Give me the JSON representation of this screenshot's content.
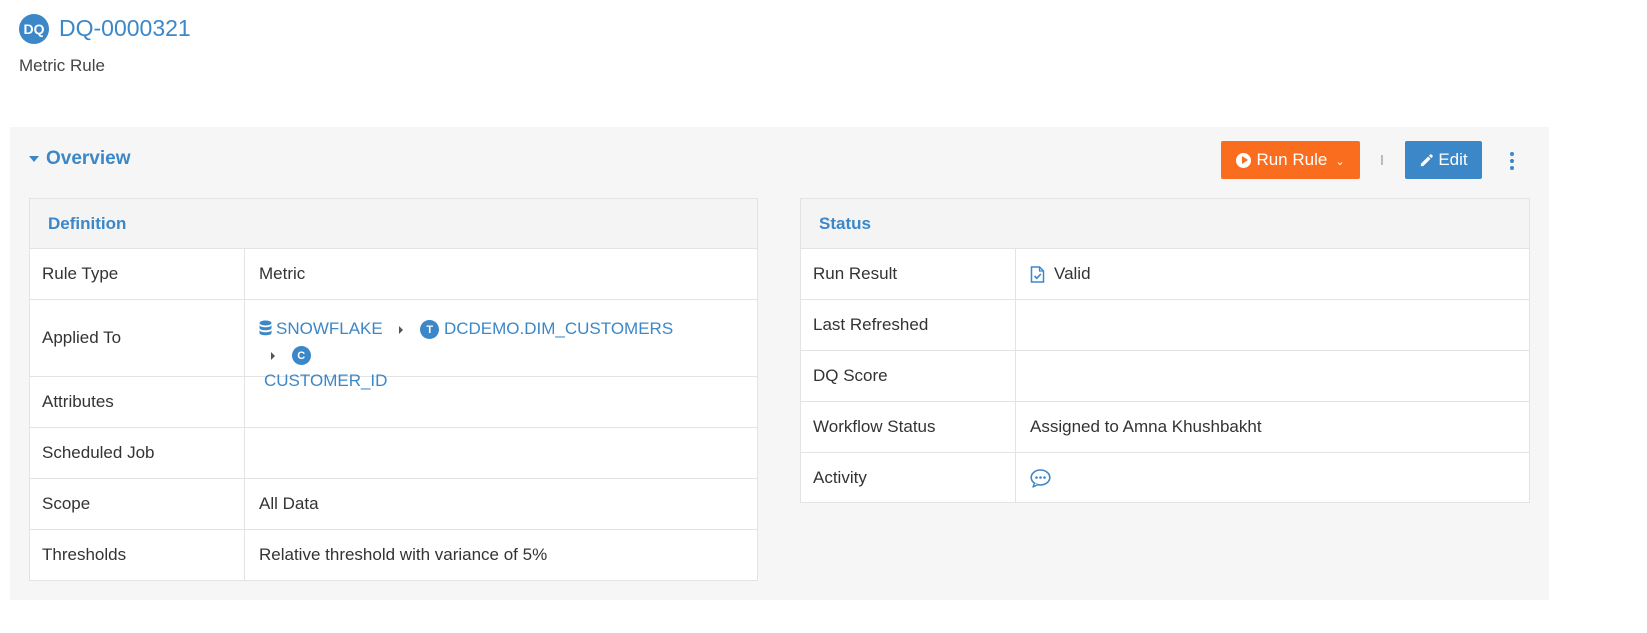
{
  "header": {
    "badge": "DQ",
    "id": "DQ-0000321",
    "subtitle": "Metric Rule"
  },
  "overview": {
    "title": "Overview"
  },
  "toolbar": {
    "run_label": "Run Rule",
    "edit_label": "Edit"
  },
  "definition": {
    "title": "Definition",
    "rows": {
      "rule_type": {
        "label": "Rule Type",
        "value": "Metric"
      },
      "applied_to": {
        "label": "Applied To",
        "db": "SNOWFLAKE",
        "table_badge": "T",
        "table": "DCDEMO.DIM_CUSTOMERS",
        "column_badge": "C",
        "column": "CUSTOMER_ID"
      },
      "attributes": {
        "label": "Attributes",
        "value": ""
      },
      "scheduled_job": {
        "label": "Scheduled Job",
        "value": ""
      },
      "scope": {
        "label": "Scope",
        "value": "All Data"
      },
      "thresholds": {
        "label": "Thresholds",
        "value": "Relative threshold with variance of 5%"
      }
    }
  },
  "status": {
    "title": "Status",
    "rows": {
      "run_result": {
        "label": "Run Result",
        "value": "Valid"
      },
      "last_refreshed": {
        "label": "Last Refreshed",
        "value": ""
      },
      "dq_score": {
        "label": "DQ Score",
        "value": ""
      },
      "workflow_status": {
        "label": "Workflow Status",
        "value": "Assigned to Amna Khushbakht"
      },
      "activity": {
        "label": "Activity",
        "icon": "comment-icon"
      }
    }
  },
  "colors": {
    "accent": "#3b87c8",
    "run_button": "#fa6d1e"
  }
}
